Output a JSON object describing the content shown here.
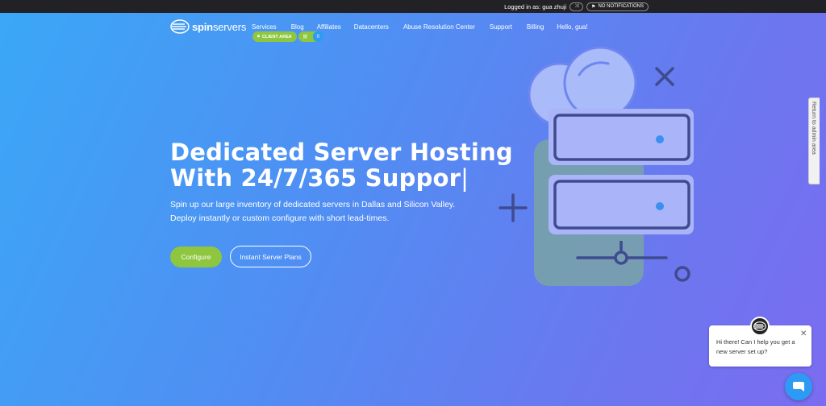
{
  "topbar": {
    "logged_in_text": "Logged in as: gua zhuji",
    "notifications_label": "NO NOTIFICATIONS"
  },
  "logo": {
    "bold": "spin",
    "thin": "servers"
  },
  "nav": {
    "items": [
      "Services",
      "Blog",
      "Affiliates",
      "Datacenters",
      "Abuse Resolution Center",
      "Support",
      "Billing",
      "Hello, gua!"
    ]
  },
  "client_area": {
    "label": "CLIENT AREA"
  },
  "cart": {
    "count": "0"
  },
  "hero": {
    "title_line1": "Dedicated Server Hosting",
    "title_line2": "With 24/7/365 Suppor",
    "cursor": "|",
    "subtitle_line1": "Spin up our large inventory of dedicated servers in Dallas and Silicon Valley.",
    "subtitle_line2": "Deploy instantly or custom configure with short lead-times.",
    "configure_label": "Configure",
    "plans_label": "Instant Server Plans"
  },
  "admin_tab": {
    "label": "Return to admin area"
  },
  "chat": {
    "message": "Hi there! Can I help you get a new server set up?"
  },
  "colors": {
    "accent_green": "#8ec63f",
    "accent_blue": "#2d9af5",
    "illustration_stroke": "#3f4b8f",
    "server_fill": "#aab4f8",
    "cloud_fill": "#a9bbf9",
    "panel_fill": "#79a3a6"
  }
}
